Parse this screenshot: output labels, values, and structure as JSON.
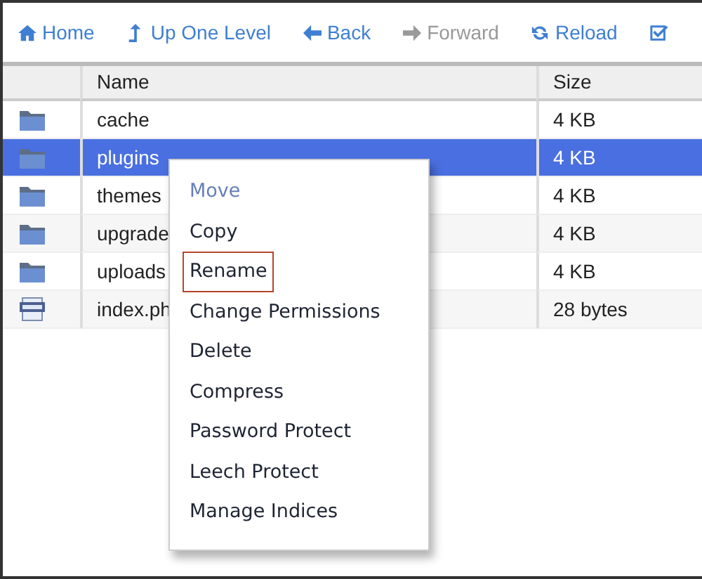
{
  "toolbar": [
    {
      "label": "Home",
      "kind": "home",
      "disabled": false
    },
    {
      "label": "Up One Level",
      "kind": "up",
      "disabled": false
    },
    {
      "label": "Back",
      "kind": "back",
      "disabled": false
    },
    {
      "label": "Forward",
      "kind": "forward",
      "disabled": true
    },
    {
      "label": "Reload",
      "kind": "reload",
      "disabled": false
    },
    {
      "kind": "check",
      "disabled": false
    }
  ],
  "table": {
    "columns": [
      "Name",
      "Size"
    ],
    "rows": [
      {
        "kind": "folder",
        "name": "cache",
        "size": "4 KB",
        "selected": false
      },
      {
        "kind": "folder",
        "name": "plugins",
        "size": "4 KB",
        "selected": true
      },
      {
        "kind": "folder",
        "name": "themes",
        "size": "4 KB",
        "selected": false
      },
      {
        "kind": "folder",
        "name": "upgrade",
        "size": "4 KB",
        "selected": false
      },
      {
        "kind": "folder",
        "name": "uploads",
        "size": "4 KB",
        "selected": false
      },
      {
        "kind": "php",
        "name": "index.ph",
        "size": "28 bytes",
        "selected": false
      }
    ]
  },
  "context_menu": [
    {
      "label": "Move",
      "disabled": true,
      "selected": false
    },
    {
      "label": "Copy",
      "disabled": false,
      "selected": false
    },
    {
      "label": "Rename",
      "disabled": false,
      "selected": true
    },
    {
      "label": "Change Permissions",
      "disabled": false,
      "selected": false
    },
    {
      "label": "Delete",
      "disabled": false,
      "selected": false
    },
    {
      "label": "Compress",
      "disabled": false,
      "selected": false
    },
    {
      "label": "Password Protect",
      "disabled": false,
      "selected": false
    },
    {
      "label": "Leech Protect",
      "disabled": false,
      "selected": false
    },
    {
      "label": "Manage Indices",
      "disabled": false,
      "selected": false
    }
  ]
}
